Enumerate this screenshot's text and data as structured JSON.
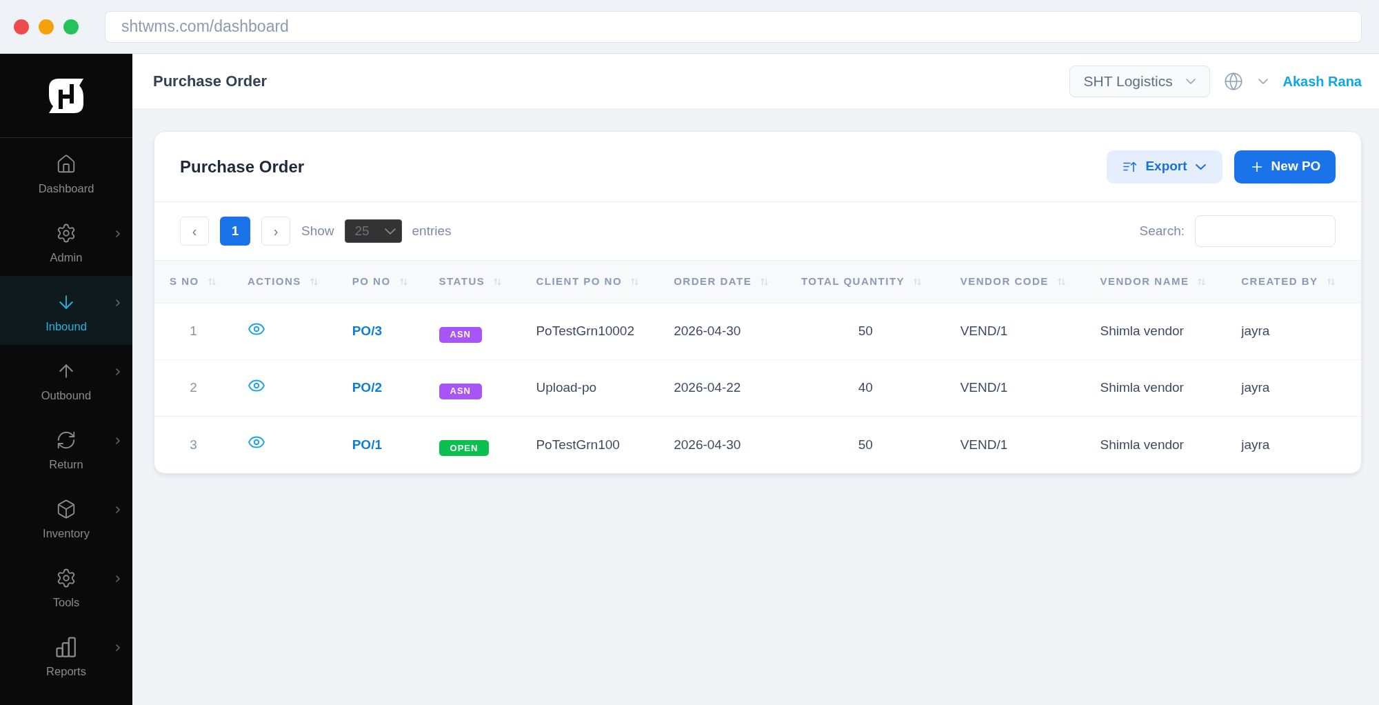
{
  "browser": {
    "url": "shtwms.com/dashboard"
  },
  "sidebar": {
    "items": [
      {
        "label": "Dashboard",
        "selected": false,
        "submenu": false
      },
      {
        "label": "Admin",
        "selected": false,
        "submenu": true
      },
      {
        "label": "Inbound",
        "selected": true,
        "submenu": true
      },
      {
        "label": "Outbound",
        "selected": false,
        "submenu": true
      },
      {
        "label": "Return",
        "selected": false,
        "submenu": true
      },
      {
        "label": "Inventory",
        "selected": false,
        "submenu": true
      },
      {
        "label": "Tools",
        "selected": false,
        "submenu": true
      },
      {
        "label": "Reports",
        "selected": false,
        "submenu": true
      }
    ]
  },
  "header": {
    "title": "Purchase Order",
    "company": "SHT Logistics",
    "user": "Akash Rana"
  },
  "card": {
    "title": "Purchase Order",
    "export_button": "Export",
    "new_button": "New PO"
  },
  "pagination": {
    "prev": "‹",
    "pages": [
      {
        "label": "1",
        "selected": true
      }
    ],
    "next": "›",
    "show_label": "Show",
    "page_size": "25",
    "entries_label": "entries"
  },
  "search": {
    "label": "Search:"
  },
  "table": {
    "columns": [
      "S NO",
      "ACTIONS",
      "PO NO",
      "STATUS",
      "CLIENT PO NO",
      "ORDER DATE",
      "TOTAL QUANTITY",
      "VENDOR CODE",
      "VENDOR NAME",
      "CREATED BY"
    ],
    "rows": [
      {
        "s_no": "1",
        "po_no": "PO/3",
        "status": {
          "label": "ASN",
          "color": "#a855f7"
        },
        "client_po_no": "PoTestGrn10002",
        "order_date": "2026-04-30",
        "total_quantity": "50",
        "vendor_code": "VEND/1",
        "vendor_name": "Shimla vendor",
        "created_by": "jayra"
      },
      {
        "s_no": "2",
        "po_no": "PO/2",
        "status": {
          "label": "ASN",
          "color": "#a855f7"
        },
        "client_po_no": "Upload-po",
        "order_date": "2026-04-22",
        "total_quantity": "40",
        "vendor_code": "VEND/1",
        "vendor_name": "Shimla vendor",
        "created_by": "jayra"
      },
      {
        "s_no": "3",
        "po_no": "PO/1",
        "status": {
          "label": "OPEN",
          "color": "#0ac04f"
        },
        "client_po_no": "PoTestGrn100",
        "order_date": "2026-04-30",
        "total_quantity": "50",
        "vendor_code": "VEND/1",
        "vendor_name": "Shimla vendor",
        "created_by": "jayra"
      }
    ]
  }
}
